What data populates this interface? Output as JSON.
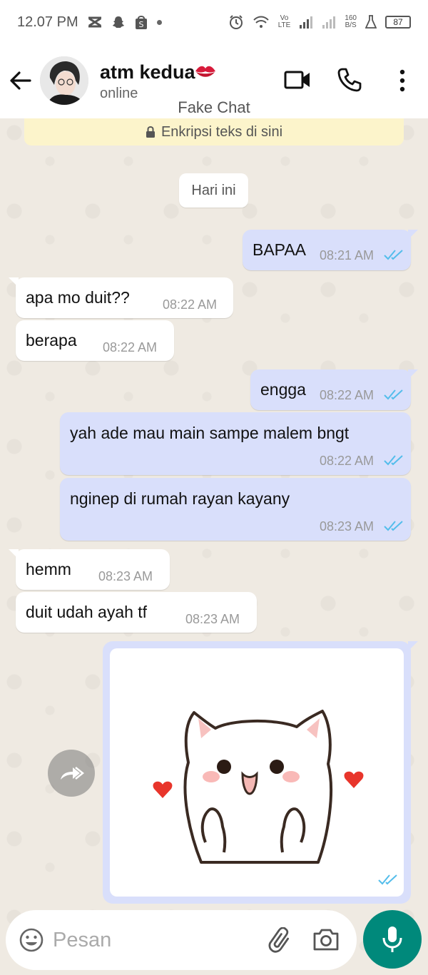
{
  "status_bar": {
    "time": "12.07 PM",
    "network_top": "Vo",
    "network_bottom": "LTE",
    "speed_top": "160",
    "speed_bottom": "B/S",
    "battery": "87"
  },
  "header": {
    "contact_name": "atm kedua",
    "contact_status": "online",
    "watermark": "Fake Chat"
  },
  "chat": {
    "encryption_notice": "Enkripsi teks di sini",
    "date_label": "Hari ini",
    "messages": [
      {
        "direction": "out",
        "text": "BAPAA",
        "time": "08:21 AM"
      },
      {
        "direction": "in",
        "text": "apa mo duit??",
        "time": "08:22 AM"
      },
      {
        "direction": "in",
        "text": "berapa",
        "time": "08:22 AM"
      },
      {
        "direction": "out",
        "text": "engga",
        "time": "08:22 AM"
      },
      {
        "direction": "out",
        "text": "yah ade mau main sampe malem bngt",
        "time": "08:22 AM"
      },
      {
        "direction": "out",
        "text": "nginep di rumah rayan kayany",
        "time": "08:23 AM"
      },
      {
        "direction": "in",
        "text": "hemm",
        "time": "08:23 AM"
      },
      {
        "direction": "in",
        "text": "duit udah ayah tf",
        "time": "08:23 AM"
      }
    ]
  },
  "input": {
    "placeholder": "Pesan"
  },
  "colors": {
    "outgoing_bubble": "#d9dffb",
    "incoming_bubble": "#ffffff",
    "read_ticks": "#53bdeb",
    "mic_button": "#00897b",
    "encryption_banner": "#fcf4cb"
  }
}
